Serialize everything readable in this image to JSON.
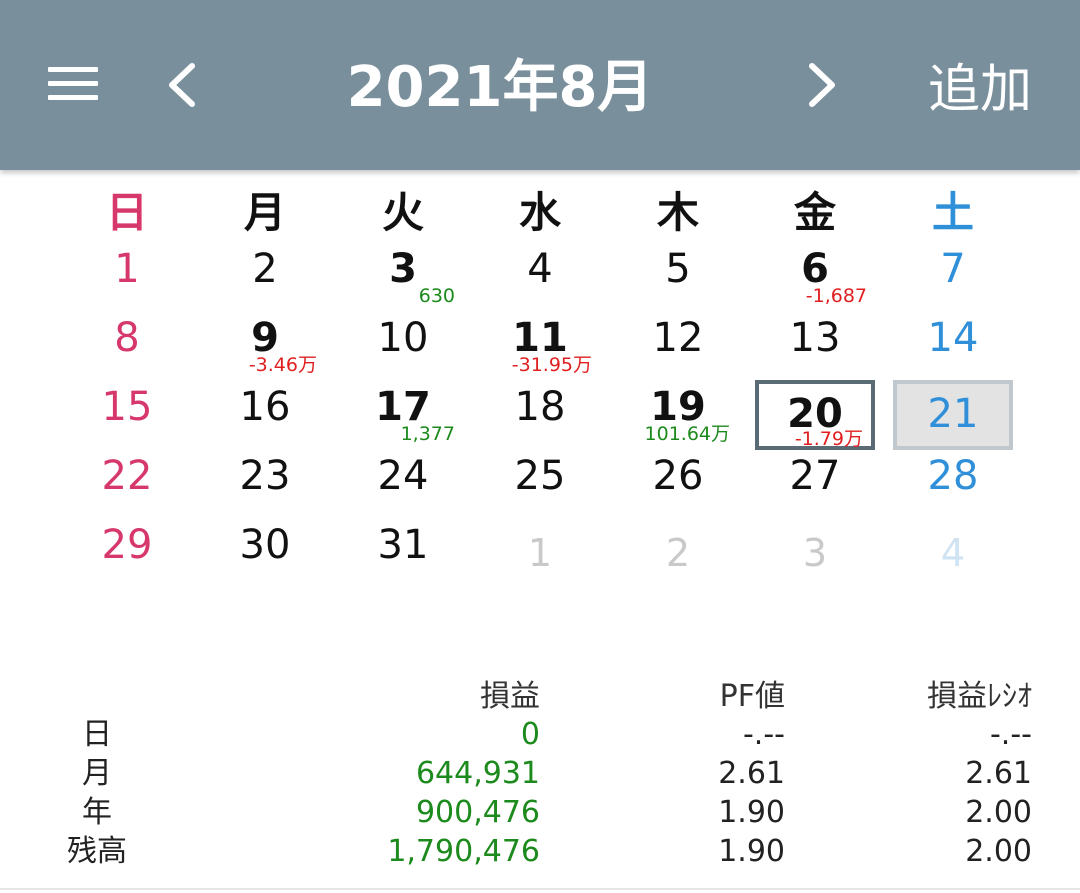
{
  "header": {
    "title": "2021年8月",
    "add_label": "追加",
    "icons": [
      "menu-icon",
      "chevron-left-icon",
      "chevron-right-icon"
    ]
  },
  "colors": {
    "appbar": "#7a8f9c",
    "sunday": "#d6386b",
    "saturday": "#2f8fd8",
    "profit": "#1c8a1c",
    "loss": "#e02020"
  },
  "weekdays": [
    "日",
    "月",
    "火",
    "水",
    "木",
    "金",
    "土"
  ],
  "weeks": [
    [
      {
        "day": "1"
      },
      {
        "day": "2"
      },
      {
        "day": "3",
        "bold": true,
        "pnl": "630",
        "sign": "pos"
      },
      {
        "day": "4"
      },
      {
        "day": "5"
      },
      {
        "day": "6",
        "bold": true,
        "pnl": "-1,687",
        "sign": "neg"
      },
      {
        "day": "7"
      }
    ],
    [
      {
        "day": "8"
      },
      {
        "day": "9",
        "bold": true,
        "pnl": "-3.46万",
        "sign": "neg"
      },
      {
        "day": "10"
      },
      {
        "day": "11",
        "bold": true,
        "pnl": "-31.95万",
        "sign": "neg"
      },
      {
        "day": "12"
      },
      {
        "day": "13"
      },
      {
        "day": "14"
      }
    ],
    [
      {
        "day": "15"
      },
      {
        "day": "16"
      },
      {
        "day": "17",
        "bold": true,
        "pnl": "1,377",
        "sign": "pos"
      },
      {
        "day": "18"
      },
      {
        "day": "19",
        "bold": true,
        "pnl": "101.64万",
        "sign": "pos"
      },
      {
        "day": "20",
        "bold": true,
        "pnl": "-1.79万",
        "sign": "neg",
        "selected": true
      },
      {
        "day": "21",
        "today": true
      }
    ],
    [
      {
        "day": "22"
      },
      {
        "day": "23"
      },
      {
        "day": "24"
      },
      {
        "day": "25"
      },
      {
        "day": "26"
      },
      {
        "day": "27"
      },
      {
        "day": "28"
      }
    ],
    [
      {
        "day": "29"
      },
      {
        "day": "30"
      },
      {
        "day": "31"
      },
      {
        "day": "1",
        "muted": true
      },
      {
        "day": "2",
        "muted": true
      },
      {
        "day": "3",
        "muted": true
      },
      {
        "day": "4",
        "muted": true
      }
    ]
  ],
  "summary": {
    "columns": [
      "損益",
      "PF値",
      "損益ﾚｼｵ"
    ],
    "rows": [
      {
        "label": "日",
        "pnl": "0",
        "pf": "-.--",
        "ratio": "-.--"
      },
      {
        "label": "月",
        "pnl": "644,931",
        "pf": "2.61",
        "ratio": "2.61"
      },
      {
        "label": "年",
        "pnl": "900,476",
        "pf": "1.90",
        "ratio": "2.00"
      },
      {
        "label": "残高",
        "pnl": "1,790,476",
        "pf": "1.90",
        "ratio": "2.00"
      }
    ]
  }
}
